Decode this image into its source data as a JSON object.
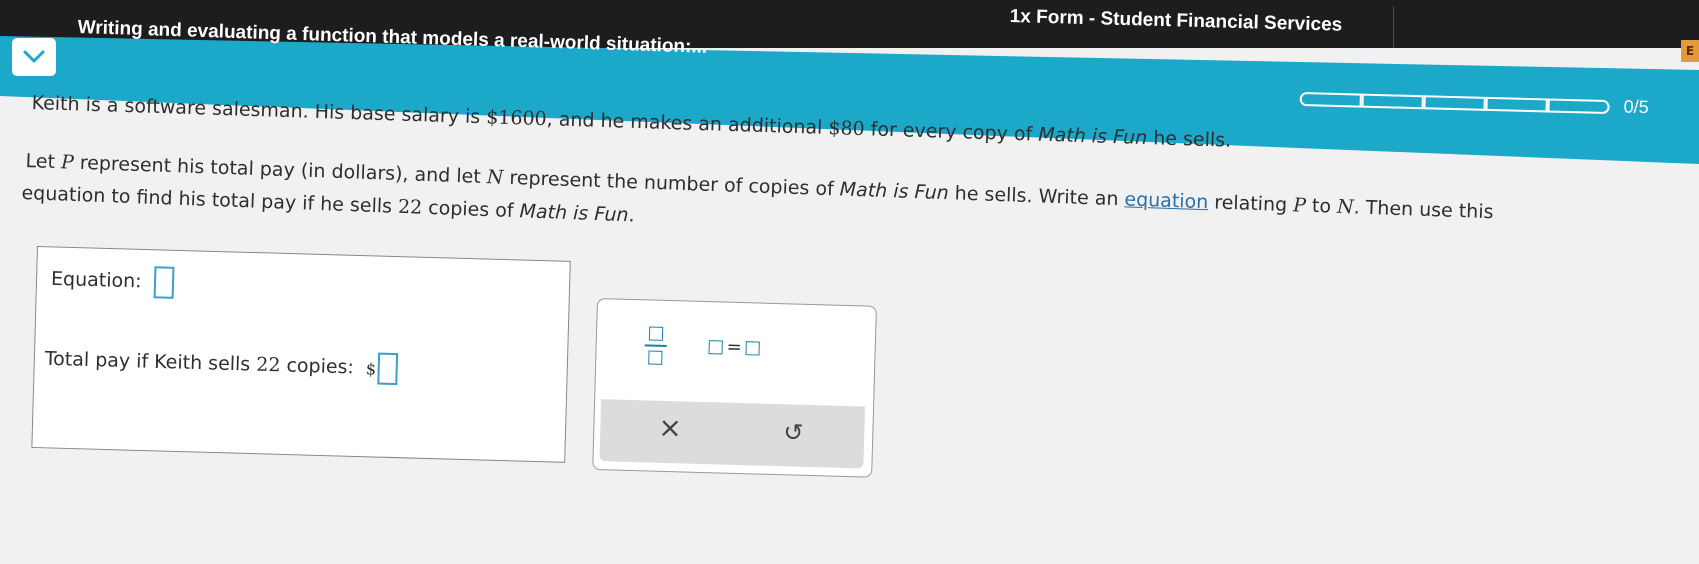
{
  "browser": {
    "tab_title": "1x Form - Student Financial Services",
    "extension_icon": "E"
  },
  "header": {
    "title": "Writing and evaluating a function that models a real-world situation:...",
    "progress": {
      "completed": 0,
      "total": 5,
      "label": "0/5"
    }
  },
  "problem": {
    "line1_a": "Keith is a software salesman. His base salary is ",
    "base_salary": "$1600",
    "line1_b": ", and he makes an additional ",
    "per_copy": "$80",
    "line1_c": " for every copy of ",
    "product": "Math is Fun",
    "line1_d": " he sells.",
    "line2_a": "Let ",
    "var_p": "P",
    "line2_b": " represent his total pay (in dollars), and let ",
    "var_n": "N",
    "line2_c": " represent the number of copies of ",
    "line2_d": " he sells. Write an ",
    "equation_link": "equation",
    "line2_e": " relating ",
    "line2_f": " to ",
    "line2_g": ". Then use this",
    "line3_a": "equation to find his total pay if he sells ",
    "copies": "22",
    "line3_b": " copies of ",
    "line3_c": "."
  },
  "answer": {
    "equation_label": "Equation:",
    "total_label_a": "Total pay if Keith sells ",
    "total_copies": "22",
    "total_label_b": " copies:",
    "currency": "$"
  },
  "palette": {
    "equals": "=",
    "clear_glyph": "×",
    "undo_glyph": "↺"
  }
}
